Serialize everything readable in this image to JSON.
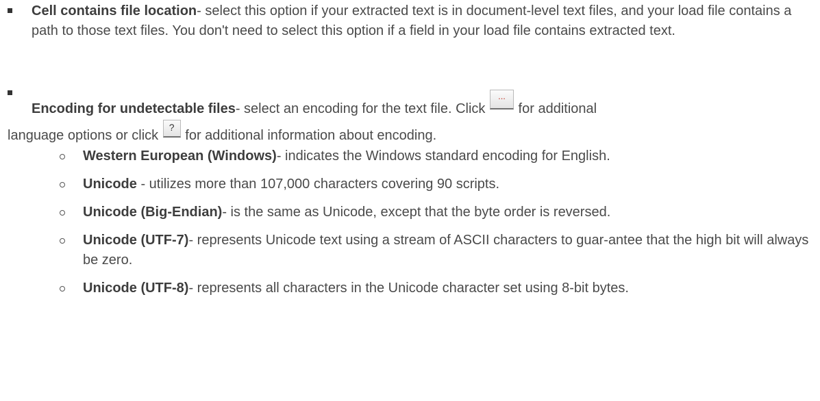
{
  "bullets": [
    {
      "title": "Cell contains file location",
      "text": "- select this option if your extracted text is in document-level text files, and your load file contains a path to those text files. You don't need to select this option if a field in your load file contains extracted text."
    },
    {
      "title": "Encoding for undetectable files",
      "text_a": "- select an encoding for the text file. Click ",
      "browse_icon_glyph": "...",
      "text_b": " for additional",
      "text_c": "language options or click ",
      "help_icon_glyph": "?",
      "text_d": " for additional information about encoding."
    }
  ],
  "encodings": [
    {
      "title": "Western European (Windows)",
      "text": "- indicates the Windows standard encoding for English."
    },
    {
      "title": "Unicode",
      "text": " - utilizes more than 107,000 characters covering 90 scripts."
    },
    {
      "title": "Unicode (Big-Endian)",
      "text": "- is the same as Unicode, except that the byte order is reversed."
    },
    {
      "title": "Unicode (UTF-7)",
      "text": "- represents Unicode text using a stream of ASCII characters to guar-antee that the high bit will always be zero."
    },
    {
      "title": "Unicode (UTF-8)",
      "text": "- represents all characters in the Unicode character set using 8-bit bytes."
    }
  ]
}
